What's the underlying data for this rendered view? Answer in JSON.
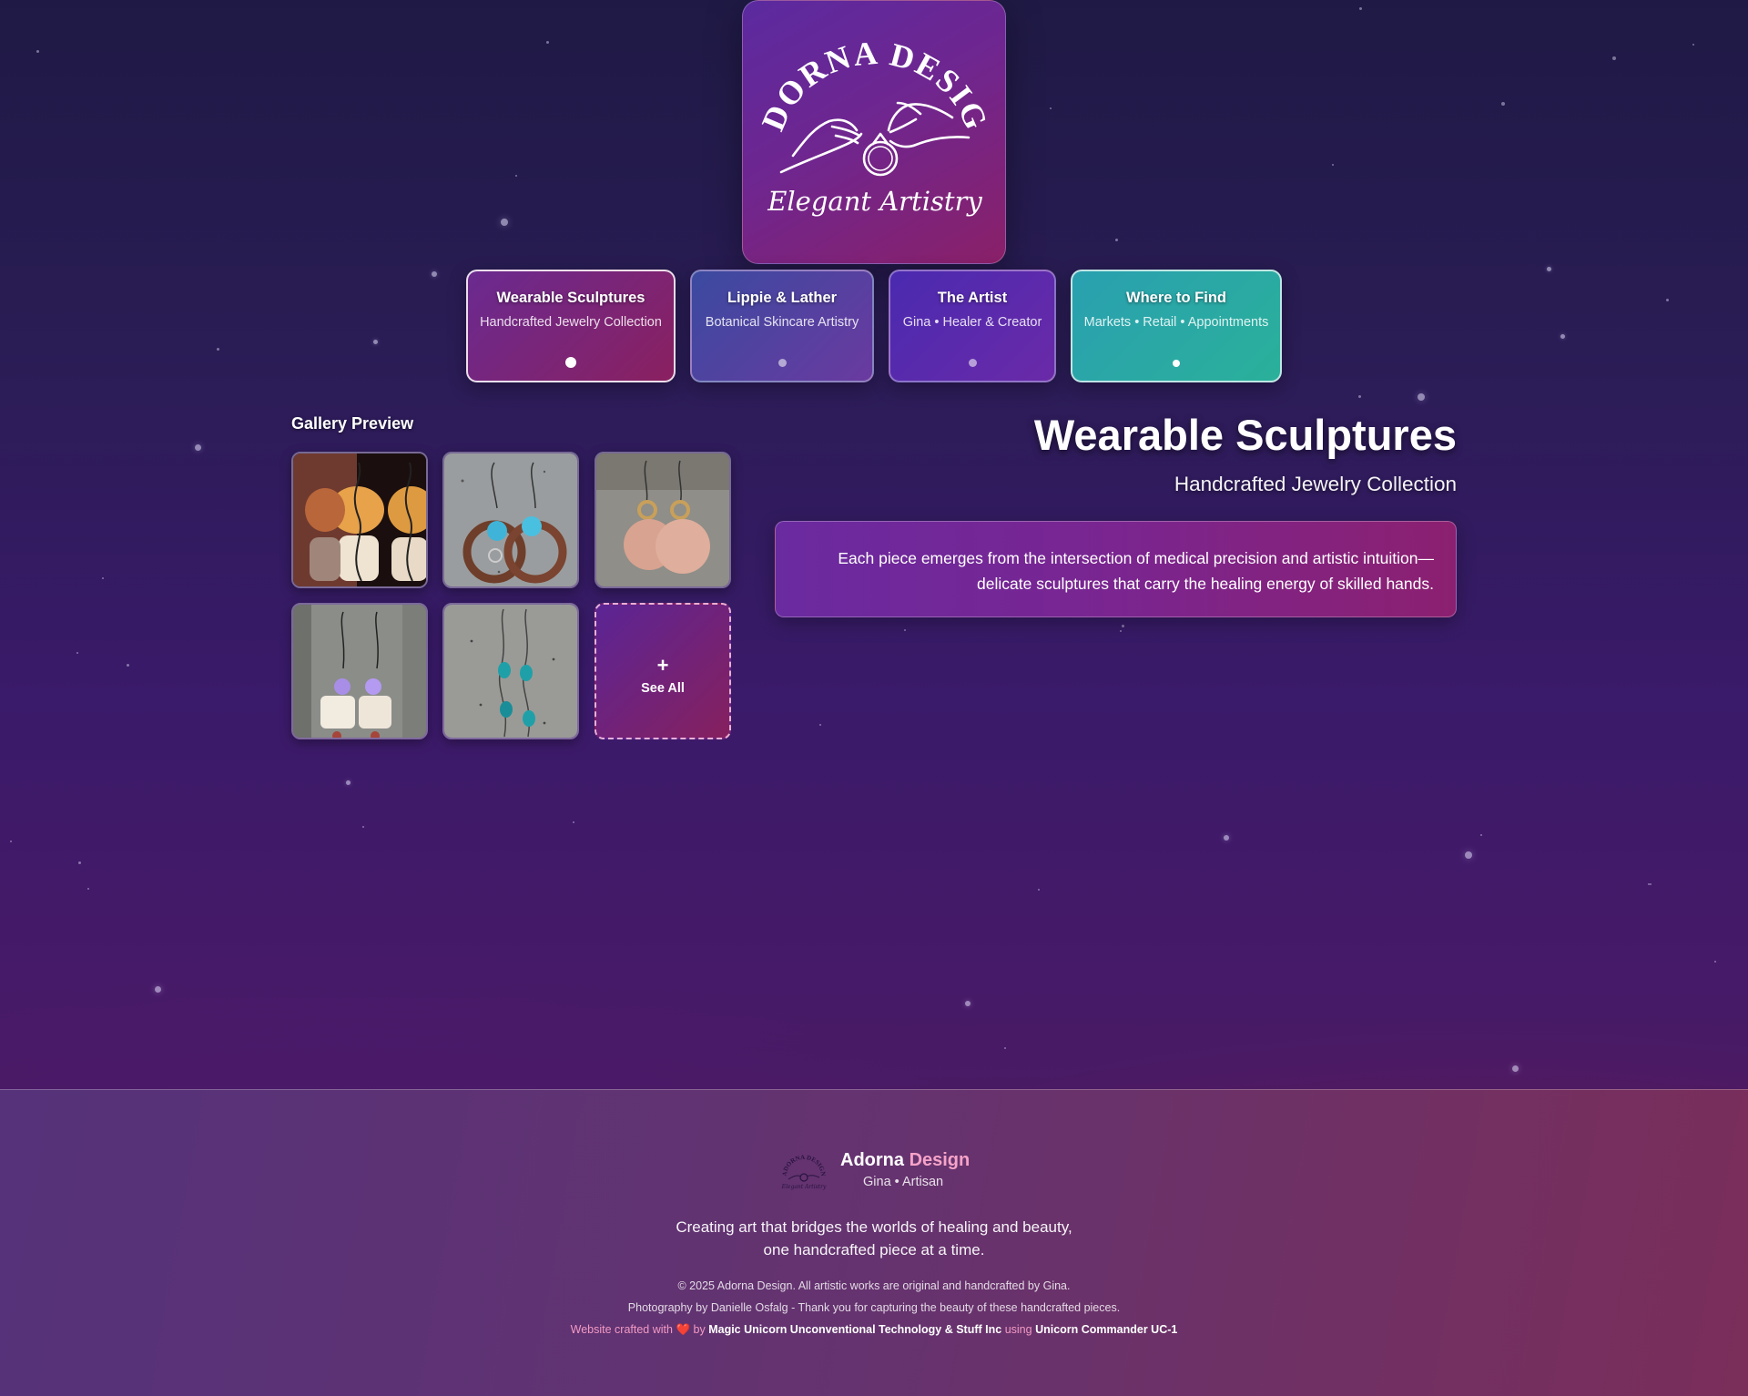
{
  "logo": {
    "arc_text": "ADORNA DESIGN",
    "script_text": "Elegant Artistry"
  },
  "nav": [
    {
      "title": "Wearable Sculptures",
      "subtitle": "Handcrafted Jewelry Collection",
      "active": true
    },
    {
      "title": "Lippie & Lather",
      "subtitle": "Botanical Skincare Artistry",
      "active": false
    },
    {
      "title": "The Artist",
      "subtitle": "Gina • Healer & Creator",
      "active": false
    },
    {
      "title": "Where to Find",
      "subtitle": "Markets • Retail • Appointments",
      "active": false
    }
  ],
  "gallery": {
    "title": "Gallery Preview",
    "see_all_icon": "+",
    "see_all_label": "See All"
  },
  "hero": {
    "title": "Wearable Sculptures",
    "subtitle": "Handcrafted Jewelry Collection",
    "description": "Each piece emerges from the intersection of medical precision and artistic intuition—delicate sculptures that carry the healing energy of skilled hands."
  },
  "footer": {
    "brand_part1": "Adorna",
    "brand_part2": "Design",
    "tagline": "Gina • Artisan",
    "mission_line1": "Creating art that bridges the worlds of healing and beauty,",
    "mission_line2": "one handcrafted piece at a time.",
    "copyright": "© 2025 Adorna Design. All artistic works are original and handcrafted by Gina.",
    "photo_credit": "Photography by Danielle Osfalg - Thank you for capturing the beauty of these handcrafted pieces.",
    "credit_prefix": "Website crafted with",
    "credit_heart": "❤️",
    "credit_by": "by",
    "credit_company": "Magic Unicorn Unconventional Technology & Stuff Inc",
    "credit_using": "using",
    "credit_product": "Unicorn Commander UC-1"
  },
  "colors": {
    "accent_pink": "#f6a3c8",
    "teal": "#2ab0a6",
    "purple": "#6a2aa0"
  }
}
